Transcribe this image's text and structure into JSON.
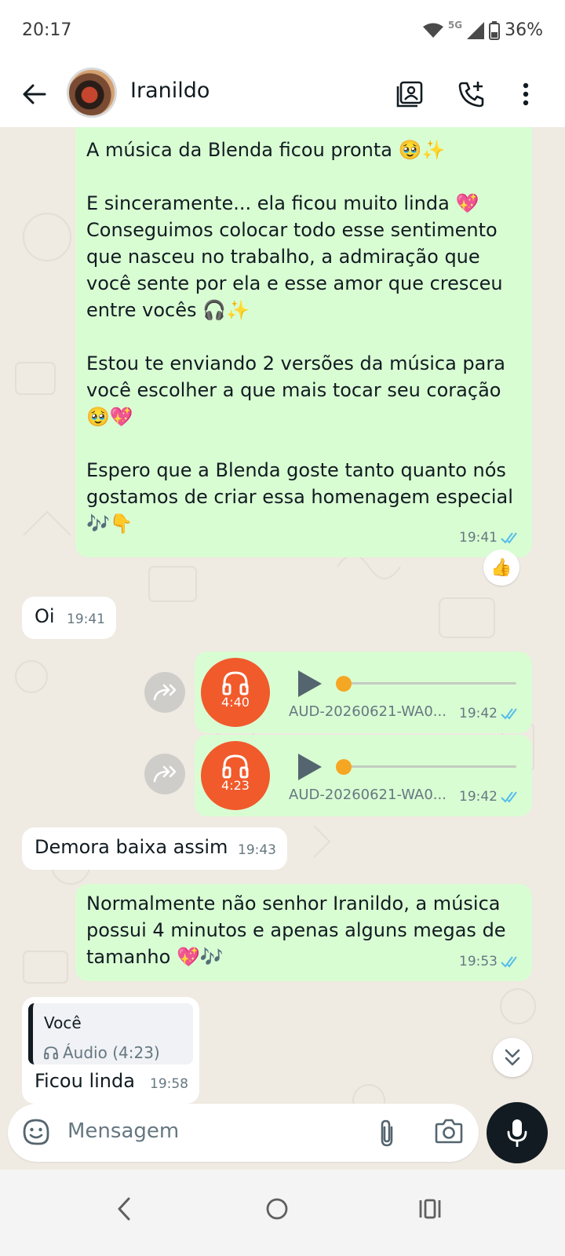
{
  "status_bar": {
    "time": "20:17",
    "network": "5G",
    "battery": "36%"
  },
  "header": {
    "contact_name": "Iranildo"
  },
  "messages": {
    "m1": {
      "text": "A música da Blenda ficou pronta 🥹✨\n\nE sinceramente... ela ficou muito linda 💖\nConseguimos colocar todo esse sentimento que nasceu no trabalho, a admiração que você sente por ela e esse amor que cresceu entre vocês 🎧✨\n\nEstou te enviando 2 versões da música para você escolher a que mais tocar seu coração 🥹💖\n\nEspero que a Blenda goste tanto quanto nós gostamos de criar essa homenagem especial 🎶👇",
      "time": "19:41",
      "reaction": "👍"
    },
    "m2": {
      "text": "Oi",
      "time": "19:41"
    },
    "a1": {
      "duration": "4:40",
      "filename": "AUD-20260621-WA0...",
      "time": "19:42"
    },
    "a2": {
      "duration": "4:23",
      "filename": "AUD-20260621-WA0...",
      "time": "19:42"
    },
    "m3": {
      "text": "Demora baixa assim",
      "time": "19:43"
    },
    "m4": {
      "text": "Normalmente não senhor Iranildo, a música possui 4 minutos e apenas alguns megas de tamanho 💖🎶",
      "time": "19:53"
    },
    "m5": {
      "quote_author": "Você",
      "quote_text": "Áudio (4:23)",
      "text": "Ficou linda",
      "time": "19:58"
    }
  },
  "composer": {
    "placeholder": "Mensagem"
  },
  "colors": {
    "outgoing_bubble": "#d9fdd3",
    "incoming_bubble": "#ffffff",
    "read_ticks": "#53bdeb",
    "audio_avatar": "#f15a2b",
    "background": "#efeae2"
  },
  "icons": [
    "back-arrow-icon",
    "contact-card-icon",
    "add-call-icon",
    "more-vert-icon",
    "forward-icon",
    "headphones-icon",
    "play-icon",
    "double-check-icon",
    "chevrons-down-icon",
    "sticker-icon",
    "attach-icon",
    "camera-icon",
    "mic-icon",
    "nav-back-icon",
    "nav-home-icon",
    "nav-recents-icon"
  ]
}
